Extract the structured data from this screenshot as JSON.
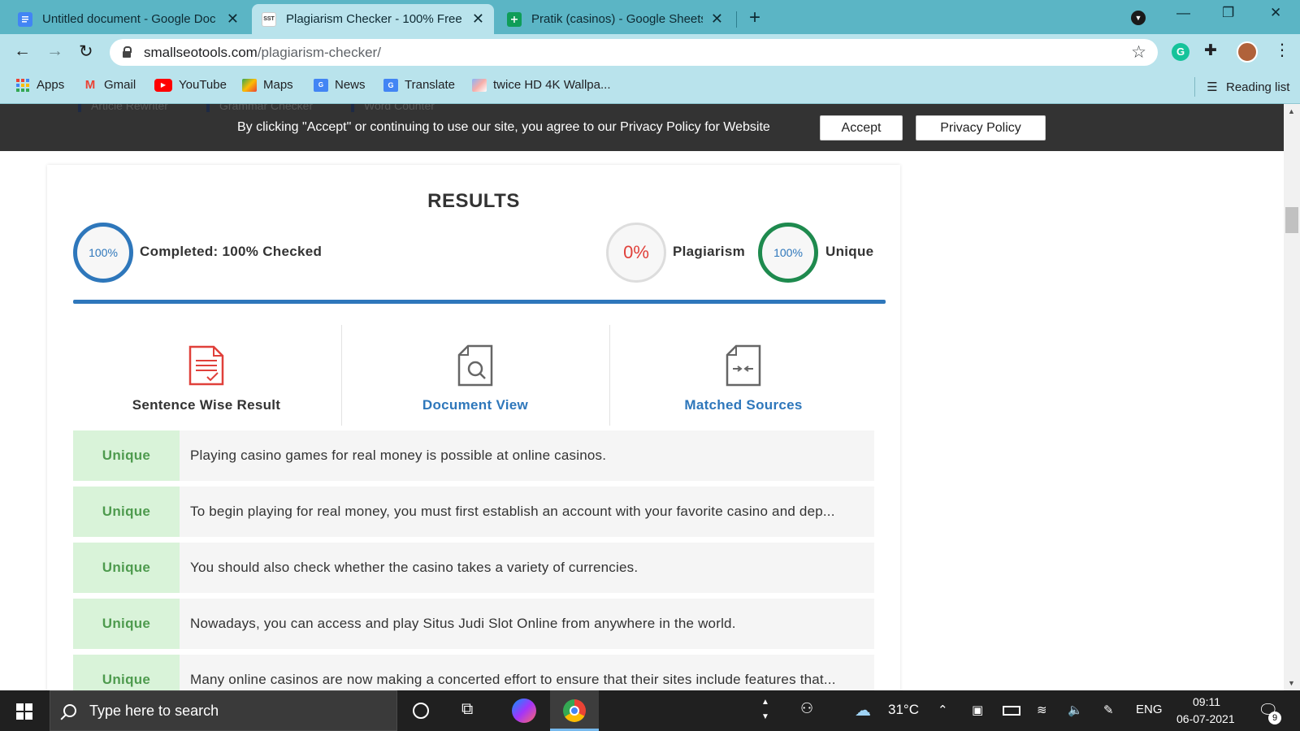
{
  "browser": {
    "tabs": [
      {
        "title": "Untitled document - Google Doc",
        "favicon": "docs-icon",
        "color": "#4285f4",
        "active": false
      },
      {
        "title": "Plagiarism Checker - 100% Free C",
        "favicon": "sst-icon",
        "favicon_text": "SST",
        "color": "#ffffff",
        "active": true
      },
      {
        "title": "Pratik (casinos) - Google Sheets",
        "favicon": "sheets-icon",
        "color": "#0f9d58",
        "active": false
      }
    ],
    "new_tab": "+",
    "address": {
      "host": "smallseotools.com",
      "path": "/plagiarism-checker/"
    },
    "bookmarks": [
      {
        "label": "Apps",
        "icon": "apps-grid-icon",
        "color": "#e94235"
      },
      {
        "label": "Gmail",
        "icon": "gmail-icon",
        "color": "#ea4335"
      },
      {
        "label": "YouTube",
        "icon": "youtube-icon",
        "color": "#ff0000"
      },
      {
        "label": "Maps",
        "icon": "maps-icon",
        "color": "#34a853"
      },
      {
        "label": "News",
        "icon": "news-icon",
        "color": "#4285f4"
      },
      {
        "label": "Translate",
        "icon": "translate-icon",
        "color": "#4285f4"
      },
      {
        "label": "twice HD 4K Wallpa...",
        "icon": "wallpaper-icon",
        "color": "#8ab4f8"
      }
    ],
    "reading_list": "Reading list"
  },
  "cookie_banner": {
    "ghost_links": [
      "Article Rewriter",
      "Grammar Checker",
      "Word Counter"
    ],
    "message": "By clicking \"Accept\" or continuing to use our site, you agree to our Privacy Policy for Website",
    "accept": "Accept",
    "privacy": "Privacy Policy"
  },
  "results": {
    "title": "RESULTS",
    "completed_ring": "100%",
    "completed_label": "Completed: 100% Checked",
    "plagiarism_ring": "0%",
    "plagiarism_label": "Plagiarism",
    "unique_ring": "100%",
    "unique_label": "Unique",
    "progress": 1.0,
    "colors": {
      "blue": "#2e77bb",
      "red": "#e0403a",
      "green": "#1e8a4e",
      "grey": "#dddddd"
    }
  },
  "view_tabs": [
    {
      "label": "Sentence Wise Result",
      "icon": "sentence-report-icon",
      "color": "#333333"
    },
    {
      "label": "Document View",
      "icon": "document-search-icon",
      "color": "#2e77bb"
    },
    {
      "label": "Matched Sources",
      "icon": "matched-sources-icon",
      "color": "#2e77bb"
    }
  ],
  "sentences": [
    {
      "status": "Unique",
      "text": "Playing casino games for real money is possible at online casinos."
    },
    {
      "status": "Unique",
      "text": "To begin playing for real money, you must first establish an account with your favorite casino and dep..."
    },
    {
      "status": "Unique",
      "text": "You should also check whether the casino takes a variety of currencies."
    },
    {
      "status": "Unique",
      "text": "Nowadays, you can access and play Situs Judi Slot Online from anywhere in the world."
    },
    {
      "status": "Unique",
      "text": "Many online casinos are now making a concerted effort to ensure that their sites include features that..."
    }
  ],
  "taskbar": {
    "search_placeholder": "Type here to search",
    "temperature": "31°C",
    "language": "ENG",
    "time": "09:11",
    "date": "06-07-2021",
    "notifications": "9"
  }
}
